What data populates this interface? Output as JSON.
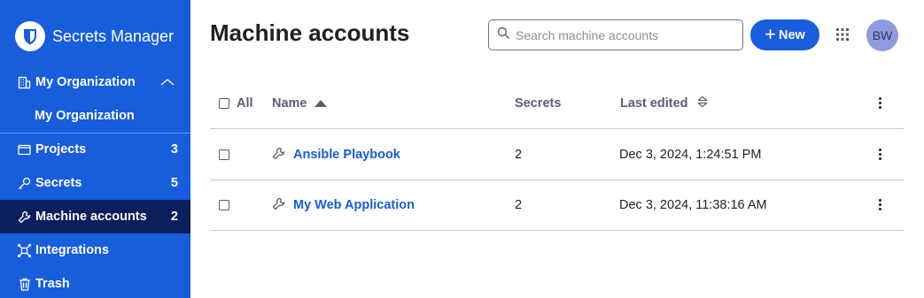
{
  "app": {
    "name": "Secrets Manager"
  },
  "sidebar": {
    "org_header": "My Organization",
    "org_sub": "My Organization",
    "items": [
      {
        "label": "Projects",
        "count": "3"
      },
      {
        "label": "Secrets",
        "count": "5"
      },
      {
        "label": "Machine accounts",
        "count": "2"
      },
      {
        "label": "Integrations"
      },
      {
        "label": "Trash"
      }
    ]
  },
  "header": {
    "title": "Machine accounts",
    "search_placeholder": "Search machine accounts",
    "new_label": "New",
    "avatar_initials": "BW"
  },
  "table": {
    "columns": {
      "all": "All",
      "name": "Name",
      "secrets": "Secrets",
      "last_edited": "Last edited"
    },
    "rows": [
      {
        "name": "Ansible Playbook",
        "secrets": "2",
        "last_edited": "Dec 3, 2024, 1:24:51 PM"
      },
      {
        "name": "My Web Application",
        "secrets": "2",
        "last_edited": "Dec 3, 2024, 11:38:16 AM"
      }
    ]
  },
  "colors": {
    "brand": "#175ddc",
    "active_nav": "#0b1f5c"
  }
}
